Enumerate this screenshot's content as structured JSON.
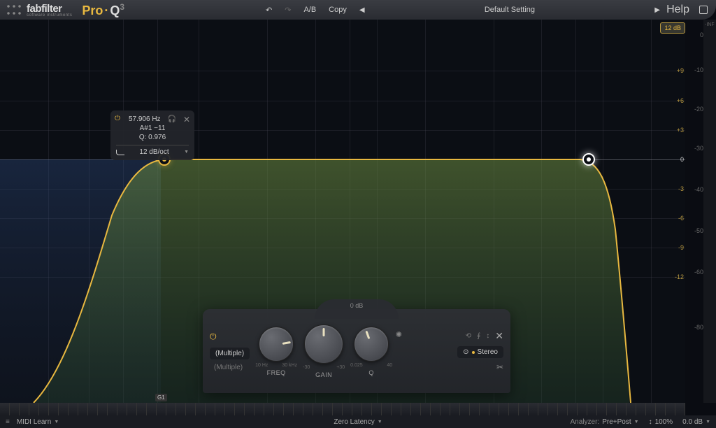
{
  "brand": {
    "name": "fabfilter",
    "tagline": "software instruments",
    "product_pro": "Pro",
    "product_q": "Q",
    "product_ver": "3"
  },
  "topbar": {
    "undo": "↶",
    "redo": "↷",
    "ab": "A/B",
    "copy": "Copy",
    "preset": "Default Setting",
    "help": "Help"
  },
  "db_range": "12 dB",
  "scale_inner": [
    {
      "v": "+9",
      "t": 73
    },
    {
      "v": "+6",
      "t": 116
    },
    {
      "v": "+3",
      "t": 158
    },
    {
      "v": "0",
      "t": 200
    },
    {
      "v": "-3",
      "t": 242
    },
    {
      "v": "-6",
      "t": 284
    },
    {
      "v": "-9",
      "t": 326
    },
    {
      "v": "-12",
      "t": 368
    }
  ],
  "scale_outer": [
    {
      "v": "0",
      "t": 22
    },
    {
      "v": "-10",
      "t": 72
    },
    {
      "v": "-20",
      "t": 128
    },
    {
      "v": "-30",
      "t": 184
    },
    {
      "v": "-40",
      "t": 243
    },
    {
      "v": "-50",
      "t": 302
    },
    {
      "v": "-60",
      "t": 361
    },
    {
      "v": "-80",
      "t": 440
    }
  ],
  "meter_top": "-INF",
  "band_tip": {
    "freq": "57.906 Hz",
    "note": "A#1 −11",
    "q": "Q: 0.976",
    "slope": "12 dB/oct"
  },
  "panel": {
    "gain_readout": "0 dB",
    "filter_type_btn": "(Multiple)",
    "filter_slope_txt": "(Multiple)",
    "freq": {
      "label": "FREQ",
      "min": "10 Hz",
      "max": "30 kHz"
    },
    "gain": {
      "label": "GAIN",
      "min": "-30",
      "max": "+30"
    },
    "q": {
      "label": "Q",
      "min": "0.025",
      "max": "40"
    },
    "stereo": "Stereo"
  },
  "piano_note": "G1",
  "bottombar": {
    "midi": "MIDI Learn",
    "latency": "Zero Latency",
    "analyzer_lbl": "Analyzer:",
    "analyzer_val": "Pre+Post",
    "scale": "100%",
    "output": "0.0 dB"
  }
}
